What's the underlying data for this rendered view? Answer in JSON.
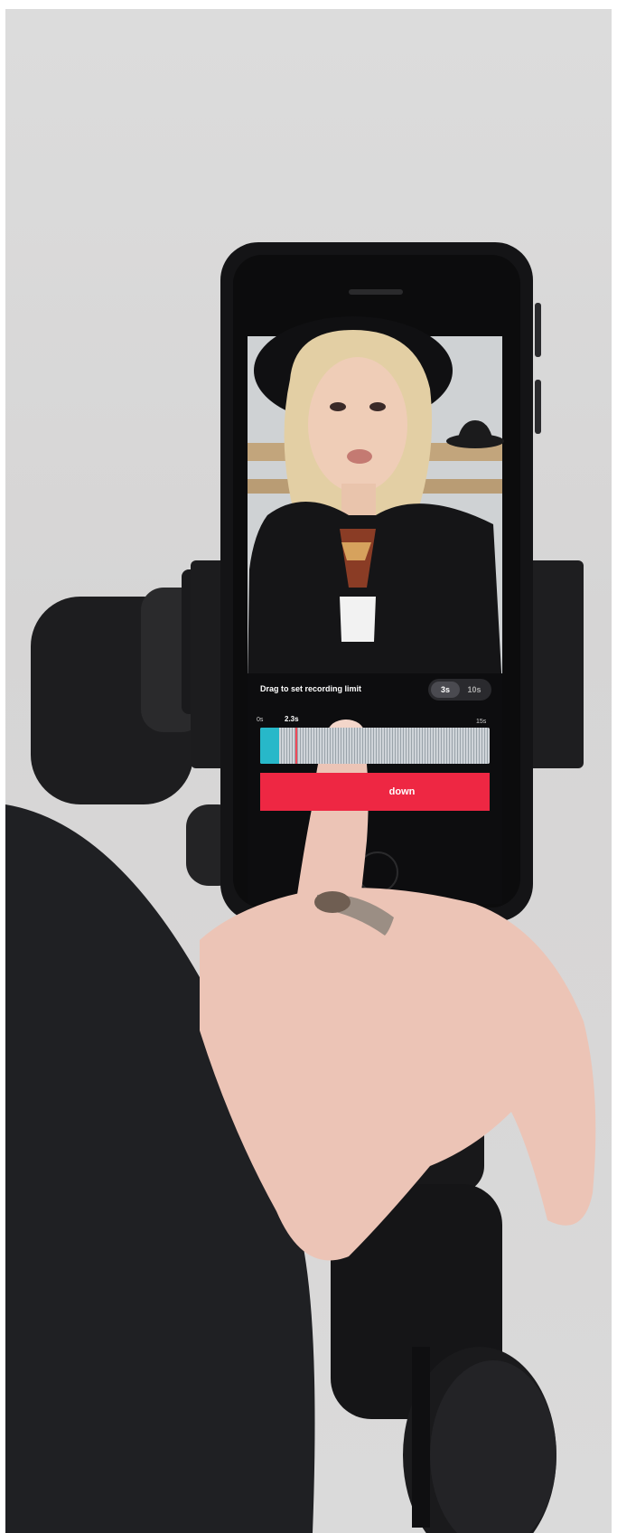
{
  "recording_panel": {
    "instruction": "Drag to set recording limit",
    "duration_options": [
      "3s",
      "10s"
    ],
    "selected_option": "3s",
    "timeline_start_label": "0s",
    "timeline_end_label": "15s",
    "marker_label": "2.3s",
    "marker_fraction": 0.153,
    "button_label_visible": "down"
  },
  "colors": {
    "accent_red": "#ee2743",
    "timeline_fill": "#27b8c9",
    "playhead": "#f04a5a"
  }
}
